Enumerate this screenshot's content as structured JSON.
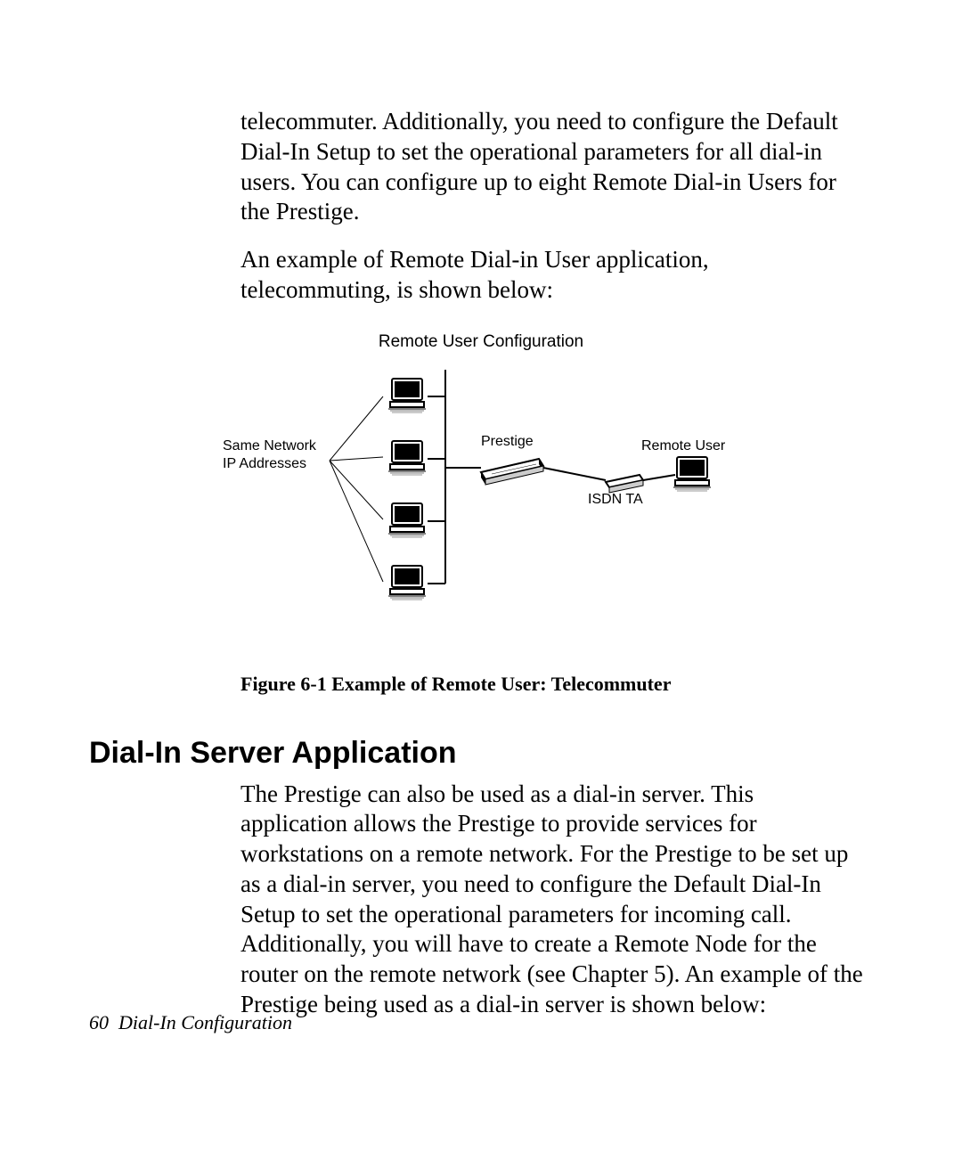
{
  "para1": "telecommuter. Additionally, you need to configure the Default Dial-In Setup to set the operational parameters for all dial-in users. You can configure up to eight Remote Dial-in Users for the Prestige.",
  "para2": "An example of Remote Dial-in User application, telecommuting, is shown below:",
  "diagram": {
    "title": "Remote User Configuration",
    "labels": {
      "same_network": "Same Network",
      "ip_addresses": "IP Addresses",
      "prestige": "Prestige",
      "remote_user": "Remote User",
      "isdn_ta": "ISDN TA"
    }
  },
  "figure_caption": "Figure 6-1 Example of Remote User: Telecommuter",
  "section_heading": "Dial-In Server Application",
  "para3": "The Prestige can also be used as a dial-in server. This application allows the Prestige to provide services for workstations on a remote network. For the Prestige to be set up as a dial-in server, you need to configure the Default Dial-In Setup to set the operational parameters for incoming call. Additionally, you will have to create a Remote Node for the router on the remote network (see Chapter 5). An example of the Prestige being used as a dial-in server is shown below:",
  "footer": {
    "page_number": "60",
    "section": "Dial-In Configuration"
  }
}
